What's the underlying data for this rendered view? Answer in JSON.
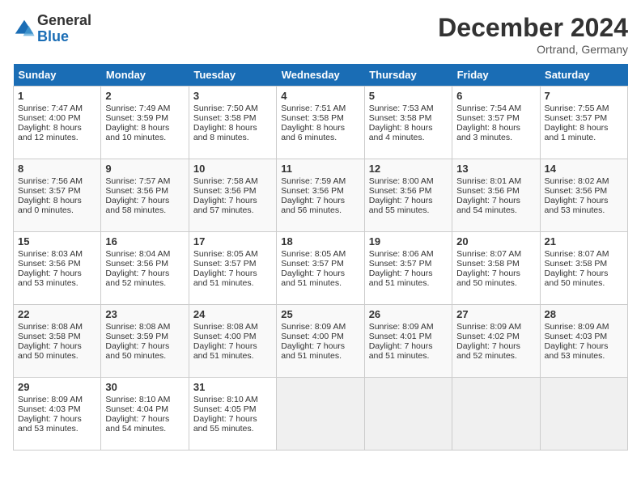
{
  "header": {
    "logo_line1": "General",
    "logo_line2": "Blue",
    "month": "December 2024",
    "location": "Ortrand, Germany"
  },
  "days_of_week": [
    "Sunday",
    "Monday",
    "Tuesday",
    "Wednesday",
    "Thursday",
    "Friday",
    "Saturday"
  ],
  "weeks": [
    [
      {
        "day": "1",
        "sunrise": "Sunrise: 7:47 AM",
        "sunset": "Sunset: 4:00 PM",
        "daylight": "Daylight: 8 hours and 12 minutes."
      },
      {
        "day": "2",
        "sunrise": "Sunrise: 7:49 AM",
        "sunset": "Sunset: 3:59 PM",
        "daylight": "Daylight: 8 hours and 10 minutes."
      },
      {
        "day": "3",
        "sunrise": "Sunrise: 7:50 AM",
        "sunset": "Sunset: 3:58 PM",
        "daylight": "Daylight: 8 hours and 8 minutes."
      },
      {
        "day": "4",
        "sunrise": "Sunrise: 7:51 AM",
        "sunset": "Sunset: 3:58 PM",
        "daylight": "Daylight: 8 hours and 6 minutes."
      },
      {
        "day": "5",
        "sunrise": "Sunrise: 7:53 AM",
        "sunset": "Sunset: 3:58 PM",
        "daylight": "Daylight: 8 hours and 4 minutes."
      },
      {
        "day": "6",
        "sunrise": "Sunrise: 7:54 AM",
        "sunset": "Sunset: 3:57 PM",
        "daylight": "Daylight: 8 hours and 3 minutes."
      },
      {
        "day": "7",
        "sunrise": "Sunrise: 7:55 AM",
        "sunset": "Sunset: 3:57 PM",
        "daylight": "Daylight: 8 hours and 1 minute."
      }
    ],
    [
      {
        "day": "8",
        "sunrise": "Sunrise: 7:56 AM",
        "sunset": "Sunset: 3:57 PM",
        "daylight": "Daylight: 8 hours and 0 minutes."
      },
      {
        "day": "9",
        "sunrise": "Sunrise: 7:57 AM",
        "sunset": "Sunset: 3:56 PM",
        "daylight": "Daylight: 7 hours and 58 minutes."
      },
      {
        "day": "10",
        "sunrise": "Sunrise: 7:58 AM",
        "sunset": "Sunset: 3:56 PM",
        "daylight": "Daylight: 7 hours and 57 minutes."
      },
      {
        "day": "11",
        "sunrise": "Sunrise: 7:59 AM",
        "sunset": "Sunset: 3:56 PM",
        "daylight": "Daylight: 7 hours and 56 minutes."
      },
      {
        "day": "12",
        "sunrise": "Sunrise: 8:00 AM",
        "sunset": "Sunset: 3:56 PM",
        "daylight": "Daylight: 7 hours and 55 minutes."
      },
      {
        "day": "13",
        "sunrise": "Sunrise: 8:01 AM",
        "sunset": "Sunset: 3:56 PM",
        "daylight": "Daylight: 7 hours and 54 minutes."
      },
      {
        "day": "14",
        "sunrise": "Sunrise: 8:02 AM",
        "sunset": "Sunset: 3:56 PM",
        "daylight": "Daylight: 7 hours and 53 minutes."
      }
    ],
    [
      {
        "day": "15",
        "sunrise": "Sunrise: 8:03 AM",
        "sunset": "Sunset: 3:56 PM",
        "daylight": "Daylight: 7 hours and 53 minutes."
      },
      {
        "day": "16",
        "sunrise": "Sunrise: 8:04 AM",
        "sunset": "Sunset: 3:56 PM",
        "daylight": "Daylight: 7 hours and 52 minutes."
      },
      {
        "day": "17",
        "sunrise": "Sunrise: 8:05 AM",
        "sunset": "Sunset: 3:57 PM",
        "daylight": "Daylight: 7 hours and 51 minutes."
      },
      {
        "day": "18",
        "sunrise": "Sunrise: 8:05 AM",
        "sunset": "Sunset: 3:57 PM",
        "daylight": "Daylight: 7 hours and 51 minutes."
      },
      {
        "day": "19",
        "sunrise": "Sunrise: 8:06 AM",
        "sunset": "Sunset: 3:57 PM",
        "daylight": "Daylight: 7 hours and 51 minutes."
      },
      {
        "day": "20",
        "sunrise": "Sunrise: 8:07 AM",
        "sunset": "Sunset: 3:58 PM",
        "daylight": "Daylight: 7 hours and 50 minutes."
      },
      {
        "day": "21",
        "sunrise": "Sunrise: 8:07 AM",
        "sunset": "Sunset: 3:58 PM",
        "daylight": "Daylight: 7 hours and 50 minutes."
      }
    ],
    [
      {
        "day": "22",
        "sunrise": "Sunrise: 8:08 AM",
        "sunset": "Sunset: 3:58 PM",
        "daylight": "Daylight: 7 hours and 50 minutes."
      },
      {
        "day": "23",
        "sunrise": "Sunrise: 8:08 AM",
        "sunset": "Sunset: 3:59 PM",
        "daylight": "Daylight: 7 hours and 50 minutes."
      },
      {
        "day": "24",
        "sunrise": "Sunrise: 8:08 AM",
        "sunset": "Sunset: 4:00 PM",
        "daylight": "Daylight: 7 hours and 51 minutes."
      },
      {
        "day": "25",
        "sunrise": "Sunrise: 8:09 AM",
        "sunset": "Sunset: 4:00 PM",
        "daylight": "Daylight: 7 hours and 51 minutes."
      },
      {
        "day": "26",
        "sunrise": "Sunrise: 8:09 AM",
        "sunset": "Sunset: 4:01 PM",
        "daylight": "Daylight: 7 hours and 51 minutes."
      },
      {
        "day": "27",
        "sunrise": "Sunrise: 8:09 AM",
        "sunset": "Sunset: 4:02 PM",
        "daylight": "Daylight: 7 hours and 52 minutes."
      },
      {
        "day": "28",
        "sunrise": "Sunrise: 8:09 AM",
        "sunset": "Sunset: 4:03 PM",
        "daylight": "Daylight: 7 hours and 53 minutes."
      }
    ],
    [
      {
        "day": "29",
        "sunrise": "Sunrise: 8:09 AM",
        "sunset": "Sunset: 4:03 PM",
        "daylight": "Daylight: 7 hours and 53 minutes."
      },
      {
        "day": "30",
        "sunrise": "Sunrise: 8:10 AM",
        "sunset": "Sunset: 4:04 PM",
        "daylight": "Daylight: 7 hours and 54 minutes."
      },
      {
        "day": "31",
        "sunrise": "Sunrise: 8:10 AM",
        "sunset": "Sunset: 4:05 PM",
        "daylight": "Daylight: 7 hours and 55 minutes."
      },
      null,
      null,
      null,
      null
    ]
  ]
}
